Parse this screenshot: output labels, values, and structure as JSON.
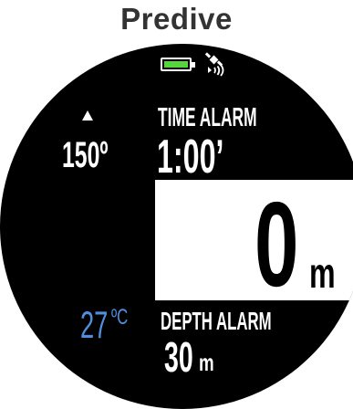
{
  "screen": {
    "title": "Predive"
  },
  "status_bar": {
    "battery_icon": "battery-full-icon",
    "gps_icon": "satellite-signal-icon",
    "battery_color": "#55d63c"
  },
  "compass": {
    "arrow_icon": "north-arrow-icon",
    "heading": "150º"
  },
  "time_alarm": {
    "label": "TIME ALARM",
    "value": "1:00’"
  },
  "depth": {
    "value": "0",
    "unit": "m"
  },
  "temperature": {
    "value": "27",
    "unit": "ºC",
    "color": "#4f8fe0"
  },
  "depth_alarm": {
    "label": "DEPTH ALARM",
    "value": "30",
    "unit": "m"
  }
}
